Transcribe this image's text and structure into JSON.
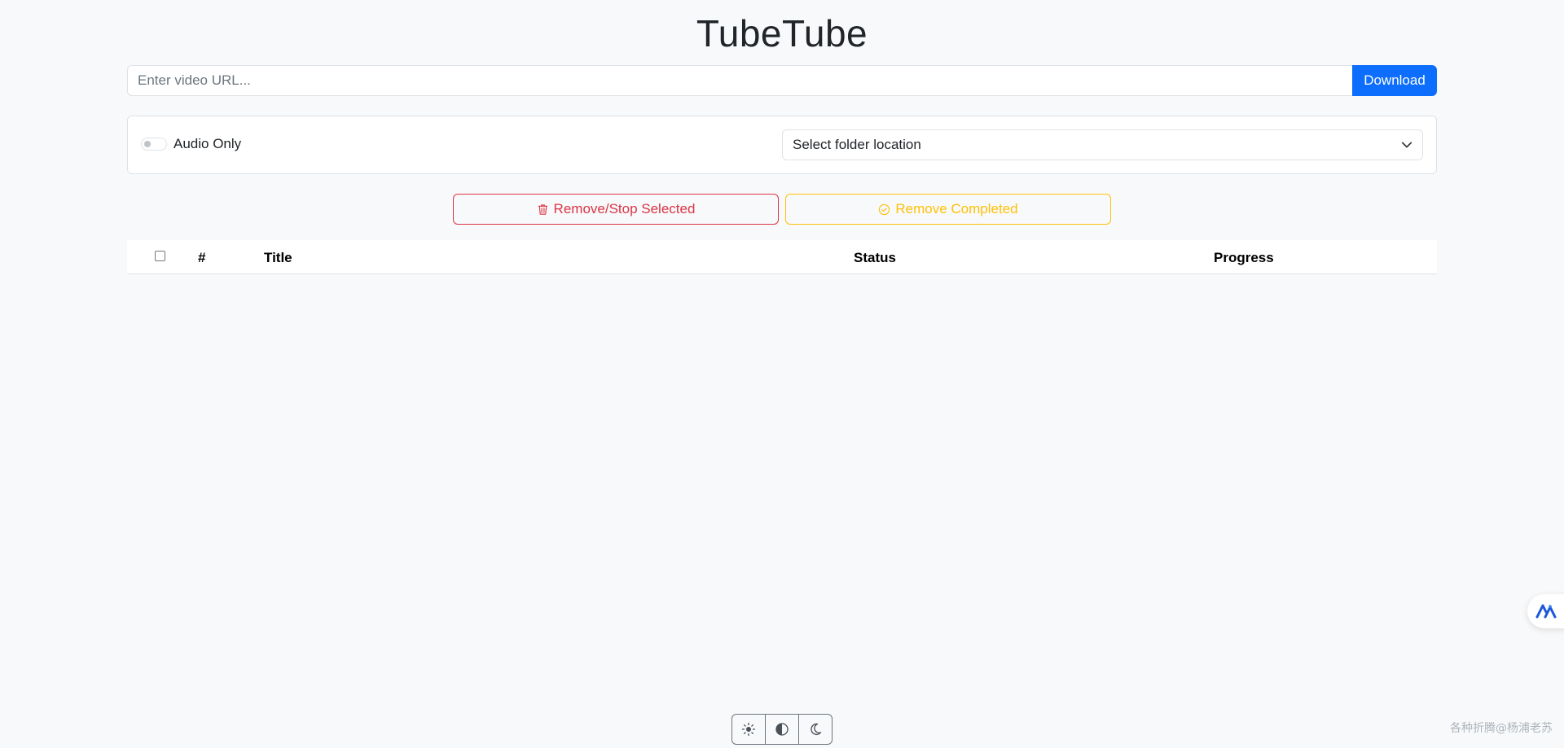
{
  "header": {
    "title": "TubeTube"
  },
  "url_bar": {
    "placeholder": "Enter video URL...",
    "download_label": "Download"
  },
  "options": {
    "audio_only_label": "Audio Only",
    "audio_only_checked": false,
    "folder_select_label": "Select folder location"
  },
  "actions": {
    "remove_stop_label": "Remove/Stop Selected",
    "remove_completed_label": "Remove Completed"
  },
  "table": {
    "columns": [
      "#",
      "Title",
      "Status",
      "Progress"
    ],
    "rows": []
  },
  "theme_switch": {
    "icons": [
      "sun-icon",
      "contrast-icon",
      "moon-icon"
    ]
  },
  "watermark": "各种折腾@杨浦老苏",
  "colors": {
    "primary": "#0d6efd",
    "danger": "#dc3545",
    "warning": "#ffc107",
    "background": "#f8f9fa"
  }
}
